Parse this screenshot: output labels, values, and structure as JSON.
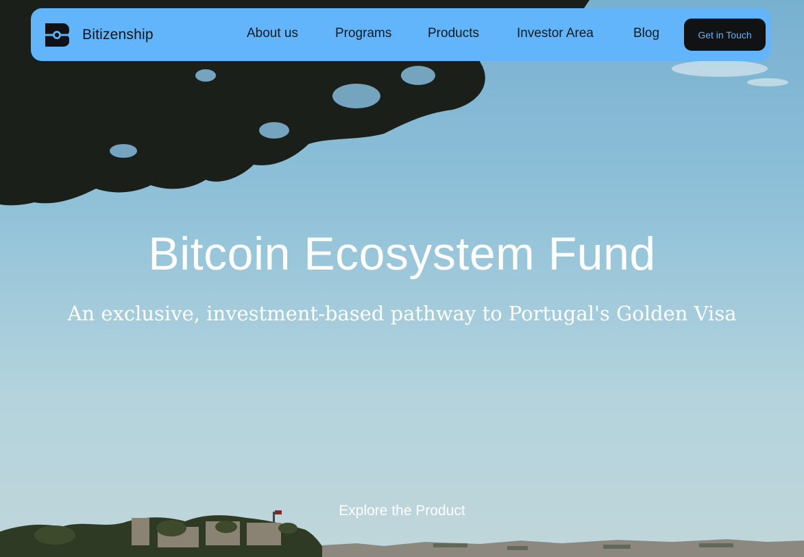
{
  "brand": {
    "name": "Bitizenship",
    "logo_icon": "bitizenship-b-logo"
  },
  "nav": {
    "items": [
      {
        "label": "About us"
      },
      {
        "label": "Programs"
      },
      {
        "label": "Products"
      },
      {
        "label": "Investor Area"
      },
      {
        "label": "Blog"
      }
    ],
    "cta_label": "Get in Touch"
  },
  "hero": {
    "title": "Bitcoin Ecosystem Fund",
    "subtitle": "An exclusive, investment-based pathway to Portugal's Golden Visa",
    "explore_label": "Explore the Product",
    "background_description_icon": "sky-trees-castle-photo"
  },
  "colors": {
    "navbar_bg": "#62b4fb",
    "cta_bg": "#111214",
    "cta_text": "#62b4fb",
    "hero_text": "#ffffff",
    "nav_text": "#131a23"
  }
}
